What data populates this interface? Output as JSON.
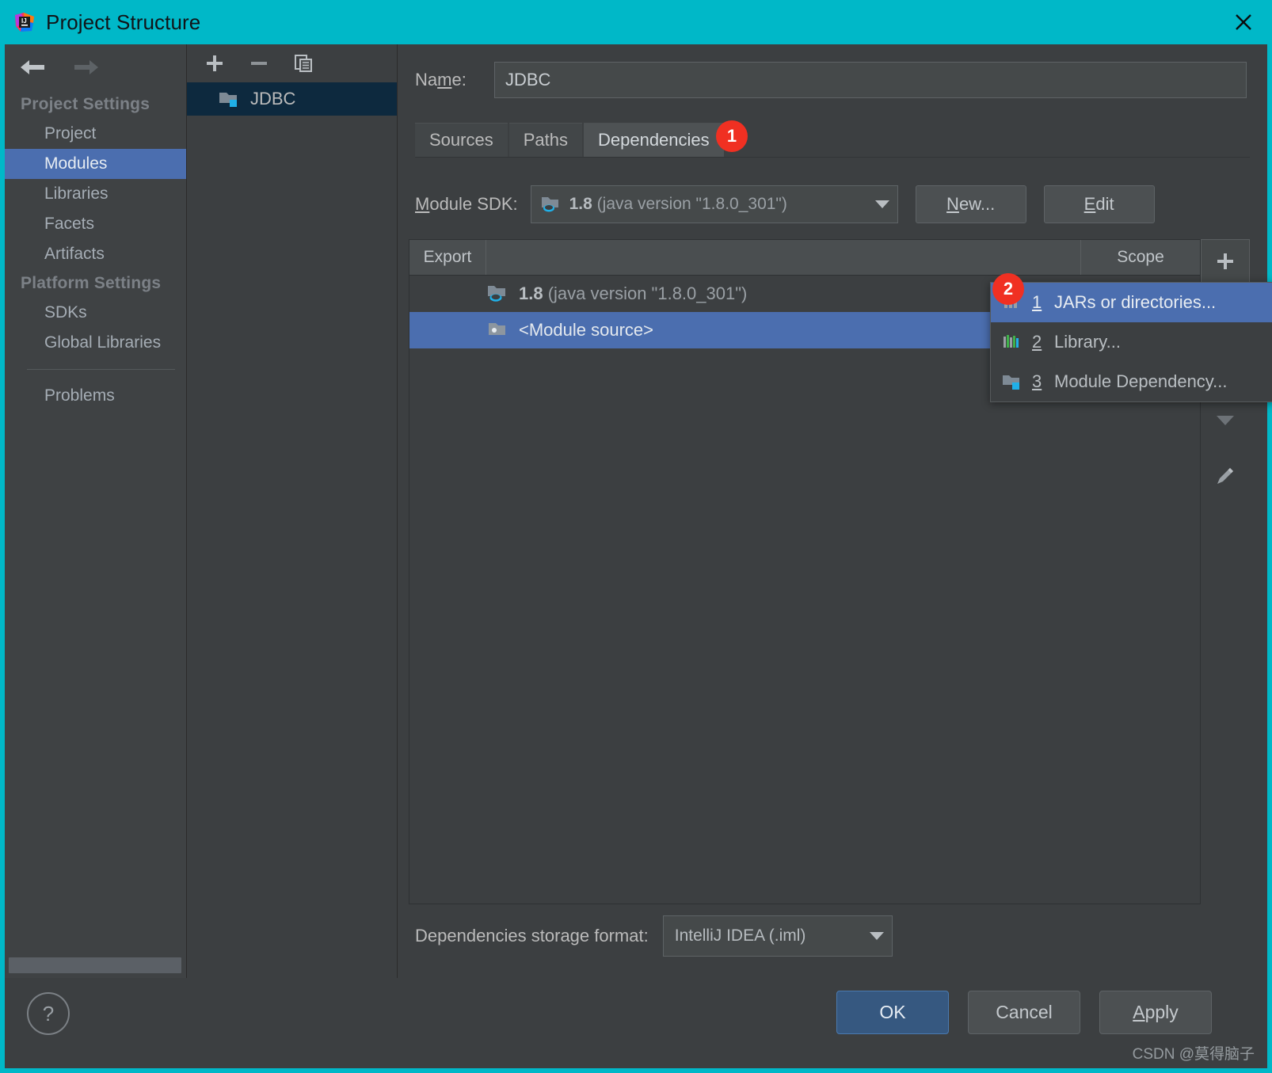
{
  "window": {
    "title": "Project Structure",
    "close_icon": "close-icon",
    "logo_icon": "intellij-idea-logo-icon"
  },
  "nav": {
    "back_icon": "arrow-left-icon",
    "forward_icon": "arrow-right-icon"
  },
  "sidebar": {
    "groups": [
      {
        "title": "Project Settings",
        "items": [
          {
            "label": "Project",
            "selected": false
          },
          {
            "label": "Modules",
            "selected": true
          },
          {
            "label": "Libraries",
            "selected": false
          },
          {
            "label": "Facets",
            "selected": false
          },
          {
            "label": "Artifacts",
            "selected": false
          }
        ]
      },
      {
        "title": "Platform Settings",
        "items": [
          {
            "label": "SDKs",
            "selected": false
          },
          {
            "label": "Global Libraries",
            "selected": false
          }
        ]
      }
    ],
    "extra_items": [
      {
        "label": "Problems",
        "selected": false
      }
    ]
  },
  "module_list": {
    "toolbar": {
      "add_icon": "plus-icon",
      "remove_icon": "minus-icon",
      "copy_icon": "copy-icon"
    },
    "items": [
      {
        "label": "JDBC",
        "icon": "module-folder-icon",
        "selected": true
      }
    ]
  },
  "main": {
    "name": {
      "label_before": "Na",
      "label_mnemonic": "m",
      "label_after": "e:",
      "value": "JDBC",
      "placeholder": ""
    },
    "tabs": [
      {
        "label": "Sources",
        "active": false
      },
      {
        "label": "Paths",
        "active": false
      },
      {
        "label": "Dependencies",
        "active": true
      }
    ],
    "sdk": {
      "label_mnemonic": "M",
      "label_rest": "odule SDK:",
      "value_bold": "1.8",
      "value_rest": " (java version \"1.8.0_301\")",
      "icon": "java-sdk-folder-icon",
      "new_button_mnemonic": "N",
      "new_button_rest": "ew...",
      "edit_button_mnemonic": "E",
      "edit_button_rest": "dit"
    },
    "dependency_table": {
      "columns": [
        "Export",
        "",
        "Scope"
      ],
      "rows": [
        {
          "icon": "java-sdk-folder-icon",
          "text_bold": "1.8",
          "text_rest": " (java version \"1.8.0_301\")",
          "export": false,
          "scope": "",
          "selected": false
        },
        {
          "icon": "module-source-icon",
          "text_bold": "",
          "text_rest": "<Module source>",
          "export": false,
          "scope": "",
          "selected": true
        }
      ]
    },
    "side_toolbar": {
      "add_icon": "plus-icon",
      "move_down_icon": "chevron-down-icon",
      "edit_icon": "pencil-edit-icon"
    },
    "storage": {
      "label": "Dependencies storage format:",
      "value": "IntelliJ IDEA (.iml)"
    }
  },
  "popup_menu": {
    "items": [
      {
        "mnemonic": "1",
        "label": "JARs or directories...",
        "icon": "jar-file-icon",
        "highlighted": true
      },
      {
        "mnemonic": "2",
        "label": "Library...",
        "icon": "library-bars-icon",
        "highlighted": false
      },
      {
        "mnemonic": "3",
        "label": "Module Dependency...",
        "icon": "module-folder-icon",
        "highlighted": false
      }
    ]
  },
  "annotations": [
    {
      "id": "1",
      "number": "1"
    },
    {
      "id": "2",
      "number": "2"
    }
  ],
  "footer": {
    "help_label": "?",
    "buttons": [
      {
        "label": "OK",
        "kind": "primary",
        "mnemonic": ""
      },
      {
        "label": "Cancel",
        "kind": "normal",
        "mnemonic": ""
      },
      {
        "label_mnemonic": "A",
        "label_rest": "pply",
        "kind": "normal"
      }
    ]
  },
  "watermark": "CSDN @莫得脑子",
  "colors": {
    "accent_cyan": "#00b8c8",
    "selection_blue": "#4b6eaf",
    "badge_red": "#f03022",
    "primary_button": "#365880",
    "panel_bg": "#3c3f41",
    "sidebar_bg": "#3f4244",
    "module_selected_bg": "#0d293e"
  }
}
